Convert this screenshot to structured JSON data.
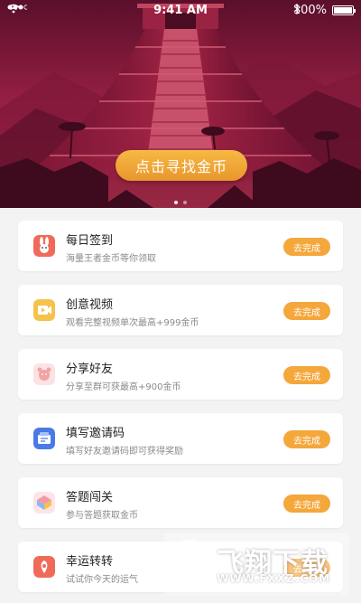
{
  "status_bar": {
    "time": "9:41 AM",
    "battery": "100%",
    "battery_level": 1.0
  },
  "hero": {
    "button_label": "点击寻找金币"
  },
  "tasks": [
    {
      "title": "每日签到",
      "subtitle": "海量王者金币等你领取",
      "action": "去完成",
      "icon": "rabbit-icon",
      "color": "#f06a5a"
    },
    {
      "title": "创意视频",
      "subtitle": "观看完整视频单次最高+999金币",
      "action": "去完成",
      "icon": "video-icon",
      "color": "#f5c24a"
    },
    {
      "title": "分享好友",
      "subtitle": "分享至群可获最高+900金币",
      "action": "去完成",
      "icon": "share-icon",
      "color": "#f3a3a3"
    },
    {
      "title": "填写邀请码",
      "subtitle": "填写好友邀请码即可获得奖励",
      "action": "去完成",
      "icon": "invite-code-icon",
      "color": "#4b7ae6"
    },
    {
      "title": "答题闯关",
      "subtitle": "参与答题获取金币",
      "action": "去完成",
      "icon": "quiz-icon",
      "color": "#f19aa6"
    },
    {
      "title": "幸运转转",
      "subtitle": "试试你今天的运气",
      "action": "去完成",
      "icon": "lucky-wheel-icon",
      "color": "#f06a5a"
    }
  ],
  "watermark": {
    "name": "飞翔下载",
    "url": "WWW.FXXZ.COM"
  }
}
